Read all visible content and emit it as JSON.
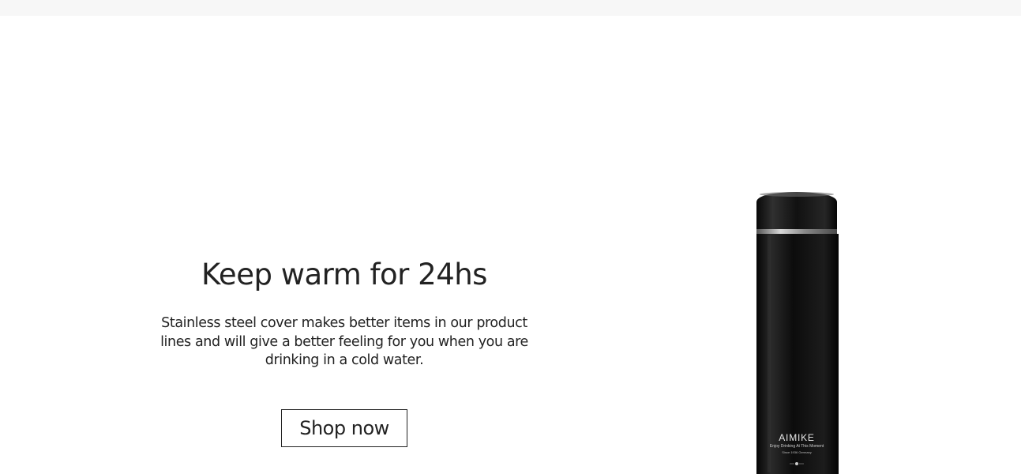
{
  "promo": {
    "headline": "Keep warm for 24hs",
    "description": "Stainless steel cover makes better items in our product lines and will give a better feeling for you when you are drinking in a cold water.",
    "button_label": "Shop now"
  },
  "product": {
    "brand": "AIMIKE",
    "tagline": "Enjoy Drinking At This Moment",
    "subline": "Since 1936 Germany"
  },
  "colors": {
    "page_background": "#ffffff",
    "top_bar": "#f7f7f7",
    "text": "#222222",
    "bottle": "#111111"
  }
}
